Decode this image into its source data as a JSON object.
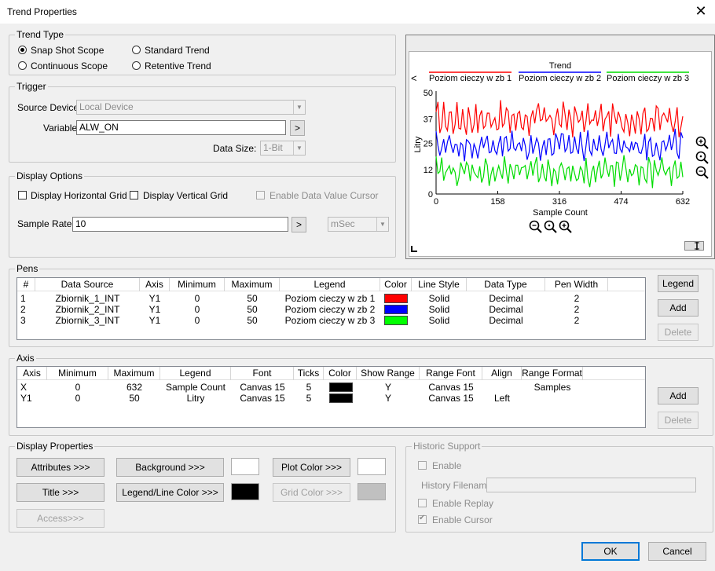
{
  "window": {
    "title": "Trend Properties",
    "close_glyph": "✕"
  },
  "trend_type": {
    "legend": "Trend Type",
    "options": [
      "Snap Shot Scope",
      "Standard Trend",
      "Continuous Scope",
      "Retentive Trend"
    ],
    "selected": "Snap Shot Scope"
  },
  "trigger": {
    "legend": "Trigger",
    "source_device_label": "Source Device:",
    "source_device_value": "Local Device",
    "variable_label": "Variable",
    "variable_value": "ALW_ON",
    "browse_label": ">",
    "data_size_label": "Data Size:",
    "data_size_value": "1-Bit"
  },
  "display_options": {
    "legend": "Display Options",
    "horizontal_grid": "Display Horizontal Grid",
    "vertical_grid": "Display Vertical Grid",
    "data_cursor": "Enable Data Value Cursor",
    "sample_rate_label": "Sample Rate:",
    "sample_rate_value": "10",
    "sample_rate_btn": ">",
    "sample_unit": "mSec"
  },
  "pens": {
    "legend": "Pens",
    "columns": [
      "#",
      "Data Source",
      "Axis",
      "Minimum",
      "Maximum",
      "Legend",
      "Color",
      "Line Style",
      "Data Type",
      "Pen Width"
    ],
    "rows": [
      {
        "n": "1",
        "source": "Zbiornik_1_INT",
        "axis": "Y1",
        "min": "0",
        "max": "50",
        "legend": "Poziom cieczy w zb 1",
        "color": "#ff0000",
        "style": "Solid",
        "type": "Decimal",
        "width": "2"
      },
      {
        "n": "2",
        "source": "Zbiornik_2_INT",
        "axis": "Y1",
        "min": "0",
        "max": "50",
        "legend": "Poziom cieczy w zb 2",
        "color": "#0000ff",
        "style": "Solid",
        "type": "Decimal",
        "width": "2"
      },
      {
        "n": "3",
        "source": "Zbiornik_3_INT",
        "axis": "Y1",
        "min": "0",
        "max": "50",
        "legend": "Poziom cieczy w zb 3",
        "color": "#00ff00",
        "style": "Solid",
        "type": "Decimal",
        "width": "2"
      }
    ],
    "legend_btn": "Legend",
    "add_btn": "Add",
    "delete_btn": "Delete"
  },
  "axis": {
    "legend": "Axis",
    "columns": [
      "Axis",
      "Minimum",
      "Maximum",
      "Legend",
      "Font",
      "Ticks",
      "Color",
      "Show Range",
      "Range Font",
      "Align",
      "Range Format"
    ],
    "rows": [
      {
        "axis": "X",
        "min": "0",
        "max": "632",
        "legend": "Sample Count",
        "font": "Canvas 15",
        "ticks": "5",
        "color": "#000000",
        "show": "Y",
        "rfont": "Canvas 15",
        "align": "",
        "format": "Samples"
      },
      {
        "axis": "Y1",
        "min": "0",
        "max": "50",
        "legend": "Litry",
        "font": "Canvas 15",
        "ticks": "5",
        "color": "#000000",
        "show": "Y",
        "rfont": "Canvas 15",
        "align": "Left",
        "format": ""
      }
    ],
    "add_btn": "Add",
    "delete_btn": "Delete"
  },
  "display_properties": {
    "legend": "Display Properties",
    "attributes_btn": "Attributes >>>",
    "background_btn": "Background >>>",
    "background_color": "#ffffff",
    "plot_color_btn": "Plot Color >>>",
    "plot_color": "#ffffff",
    "title_btn": "Title >>>",
    "legend_line_btn": "Legend/Line Color >>>",
    "legend_line_color": "#000000",
    "grid_color_btn": "Grid Color >>>",
    "grid_color": "#c0c0c0",
    "access_btn": "Access>>>"
  },
  "historic": {
    "legend": "Historic Support",
    "enable": "Enable",
    "history_filename_label": "History Filename",
    "history_filename_value": "",
    "enable_replay": "Enable Replay",
    "enable_cursor": "Enable Cursor"
  },
  "footer": {
    "ok": "OK",
    "cancel": "Cancel"
  },
  "preview": {
    "left_arrow": "<",
    "zoom_in_icon": "zoom-in-icon",
    "zoom_reset_icon": "zoom-reset-icon",
    "zoom_out_icon": "zoom-out-icon"
  },
  "chart_data": {
    "type": "line",
    "title": "Trend",
    "xlabel": "Sample Count",
    "ylabel": "Litry",
    "xlim": [
      0,
      632
    ],
    "ylim": [
      0,
      50
    ],
    "xticks": [
      "0",
      "158",
      "316",
      "474",
      "632"
    ],
    "yticks": [
      "0",
      "12",
      "25",
      "37",
      "50"
    ],
    "legend_placement": "top",
    "series": [
      {
        "name": "Poziom cieczy w zb 1",
        "color": "#ff0000",
        "center": 37,
        "amplitude": 9
      },
      {
        "name": "Poziom cieczy w zb 2",
        "color": "#0000ff",
        "center": 24,
        "amplitude": 8
      },
      {
        "name": "Poziom cieczy w zb 3",
        "color": "#00dd00",
        "center": 11,
        "amplitude": 8
      }
    ]
  }
}
